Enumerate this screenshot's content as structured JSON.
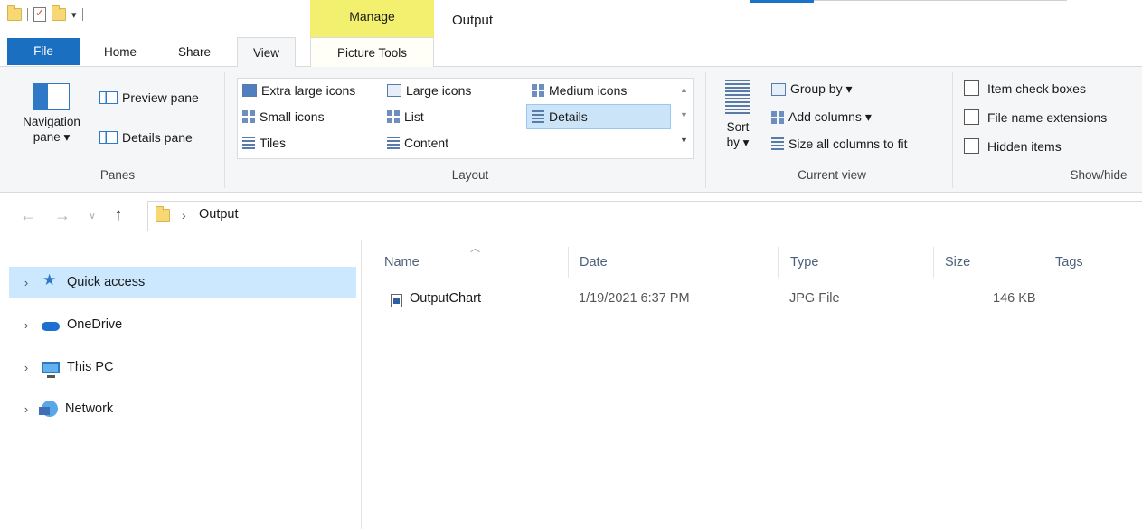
{
  "window": {
    "title": "Output",
    "contextual_tab_group": "Manage"
  },
  "ribbon_tabs": {
    "file": "File",
    "home": "Home",
    "share": "Share",
    "view": "View",
    "picture_tools": "Picture Tools"
  },
  "panes": {
    "navigation_pane_line1": "Navigation",
    "navigation_pane_line2": "pane ▾",
    "preview_pane": "Preview pane",
    "details_pane": "Details pane",
    "label": "Panes"
  },
  "layout": {
    "extra_large_icons": "Extra large icons",
    "large_icons": "Large icons",
    "medium_icons": "Medium icons",
    "small_icons": "Small icons",
    "list": "List",
    "details": "Details",
    "tiles": "Tiles",
    "content": "Content",
    "label": "Layout",
    "selected": "Details"
  },
  "current_view": {
    "sort_by_line1": "Sort",
    "sort_by_line2": "by ▾",
    "group_by": "Group by ▾",
    "add_columns": "Add columns ▾",
    "size_all_columns": "Size all columns to fit",
    "label": "Current view"
  },
  "show_hide": {
    "item_check_boxes": "Item check boxes",
    "file_name_extensions": "File name extensions",
    "hidden_items": "Hidden items",
    "label": "Show/hide"
  },
  "address": {
    "crumb": "Output"
  },
  "nav_pane": {
    "items": [
      {
        "label": "Quick access",
        "icon": "star-icon"
      },
      {
        "label": "OneDrive",
        "icon": "cloud-icon"
      },
      {
        "label": "This PC",
        "icon": "computer-icon"
      },
      {
        "label": "Network",
        "icon": "network-icon"
      }
    ]
  },
  "file_list": {
    "columns": [
      "Name",
      "Date",
      "Type",
      "Size",
      "Tags"
    ],
    "rows": [
      {
        "name": "OutputChart",
        "date": "1/19/2021 6:37 PM",
        "type": "JPG File",
        "size": "146 KB",
        "tags": ""
      }
    ]
  },
  "colors": {
    "accent": "#1a6fc1",
    "manage_highlight": "#f4f06f",
    "selection": "#cce8ff"
  }
}
